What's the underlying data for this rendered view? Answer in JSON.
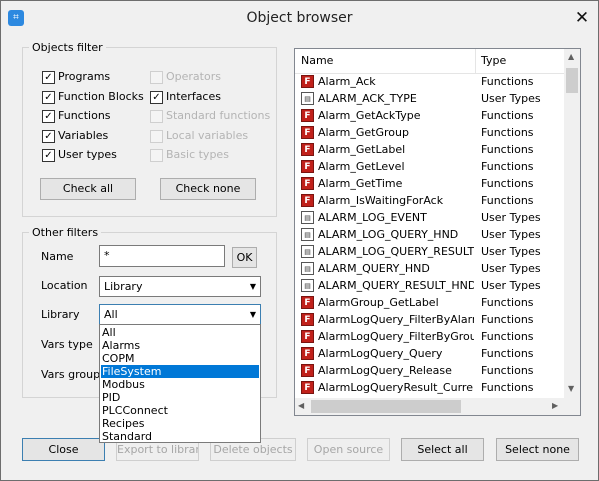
{
  "window": {
    "title": "Object browser",
    "close_glyph": "✕",
    "app_icon_glyph": "⌗"
  },
  "objects_filter": {
    "legend": "Objects filter",
    "checkboxes": [
      {
        "label": "Programs",
        "checked": true,
        "enabled": true
      },
      {
        "label": "Function Blocks",
        "checked": true,
        "enabled": true
      },
      {
        "label": "Functions",
        "checked": true,
        "enabled": true
      },
      {
        "label": "Variables",
        "checked": true,
        "enabled": true
      },
      {
        "label": "User types",
        "checked": true,
        "enabled": true
      },
      {
        "label": "Operators",
        "checked": false,
        "enabled": false
      },
      {
        "label": "Interfaces",
        "checked": true,
        "enabled": true
      },
      {
        "label": "Standard functions",
        "checked": false,
        "enabled": false
      },
      {
        "label": "Local variables",
        "checked": false,
        "enabled": false
      },
      {
        "label": "Basic types",
        "checked": false,
        "enabled": false
      }
    ],
    "check_all_label": "Check all",
    "check_none_label": "Check none",
    "check_mark": "✓"
  },
  "other_filters": {
    "legend": "Other filters",
    "name_label": "Name",
    "name_value": "*",
    "ok_label": "OK",
    "location_label": "Location",
    "location_value": "Library",
    "library_label": "Library",
    "library_value": "All",
    "vars_type_label": "Vars type",
    "vars_group_label": "Vars group",
    "dropdown_arrow": "▼",
    "library_options": [
      {
        "label": "All",
        "selected": false
      },
      {
        "label": "Alarms",
        "selected": false
      },
      {
        "label": "COPM",
        "selected": false
      },
      {
        "label": "FileSystem",
        "selected": true
      },
      {
        "label": "Modbus",
        "selected": false
      },
      {
        "label": "PID",
        "selected": false
      },
      {
        "label": "PLCConnect",
        "selected": false
      },
      {
        "label": "Recipes",
        "selected": false
      },
      {
        "label": "Standard",
        "selected": false
      }
    ]
  },
  "object_list": {
    "columns": {
      "name": "Name",
      "type": "Type"
    },
    "rows": [
      {
        "name": "Alarm_Ack",
        "type": "Functions",
        "icon": "function-icon"
      },
      {
        "name": "ALARM_ACK_TYPE",
        "type": "User Types",
        "icon": "user-type-icon"
      },
      {
        "name": "Alarm_GetAckType",
        "type": "Functions",
        "icon": "function-icon"
      },
      {
        "name": "Alarm_GetGroup",
        "type": "Functions",
        "icon": "function-icon"
      },
      {
        "name": "Alarm_GetLabel",
        "type": "Functions",
        "icon": "function-icon"
      },
      {
        "name": "Alarm_GetLevel",
        "type": "Functions",
        "icon": "function-icon"
      },
      {
        "name": "Alarm_GetTime",
        "type": "Functions",
        "icon": "function-icon"
      },
      {
        "name": "Alarm_IsWaitingForAck",
        "type": "Functions",
        "icon": "function-icon"
      },
      {
        "name": "ALARM_LOG_EVENT",
        "type": "User Types",
        "icon": "user-type-icon"
      },
      {
        "name": "ALARM_LOG_QUERY_HND",
        "type": "User Types",
        "icon": "user-type-icon"
      },
      {
        "name": "ALARM_LOG_QUERY_RESULT...",
        "type": "User Types",
        "icon": "user-type-icon"
      },
      {
        "name": "ALARM_QUERY_HND",
        "type": "User Types",
        "icon": "user-type-icon"
      },
      {
        "name": "ALARM_QUERY_RESULT_HND",
        "type": "User Types",
        "icon": "user-type-icon"
      },
      {
        "name": "AlarmGroup_GetLabel",
        "type": "Functions",
        "icon": "function-icon"
      },
      {
        "name": "AlarmLogQuery_FilterByAlarm",
        "type": "Functions",
        "icon": "function-icon"
      },
      {
        "name": "AlarmLogQuery_FilterByGroup",
        "type": "Functions",
        "icon": "function-icon"
      },
      {
        "name": "AlarmLogQuery_Query",
        "type": "Functions",
        "icon": "function-icon"
      },
      {
        "name": "AlarmLogQuery_Release",
        "type": "Functions",
        "icon": "function-icon"
      },
      {
        "name": "AlarmLogQueryResult_Current",
        "type": "Functions",
        "icon": "function-icon"
      }
    ],
    "function_icon_glyph": "F",
    "user_type_icon_glyph": "▤",
    "scroll_up_glyph": "▲",
    "scroll_down_glyph": "▼",
    "scroll_left_glyph": "◀",
    "scroll_right_glyph": "▶"
  },
  "buttons": {
    "close": "Close",
    "export_to_library": "Export to library",
    "delete_objects": "Delete objects",
    "open_source": "Open source",
    "select_all": "Select all",
    "select_none": "Select none"
  }
}
